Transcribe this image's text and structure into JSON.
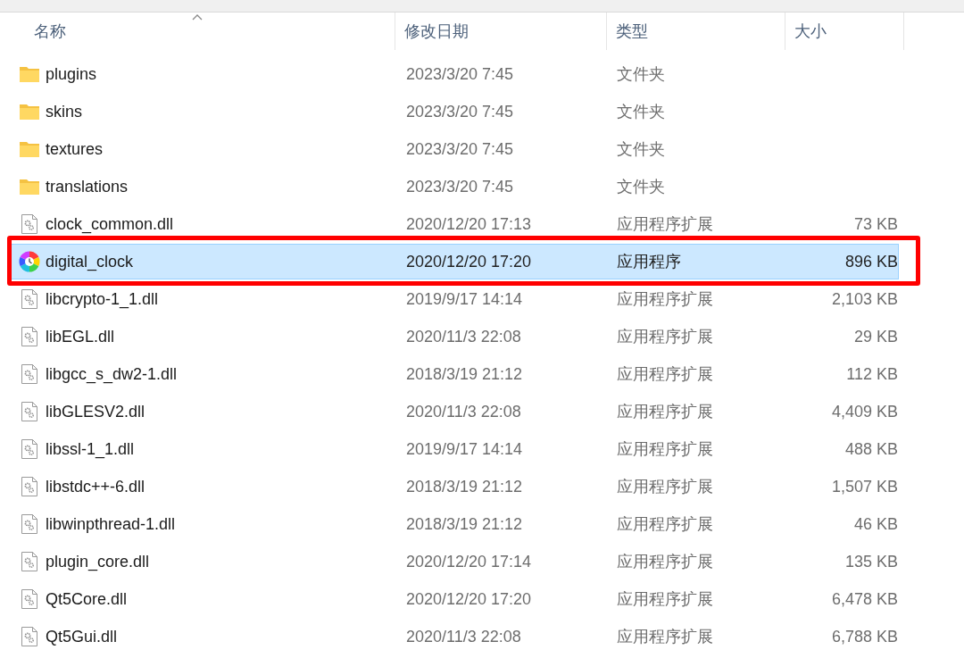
{
  "columns": [
    {
      "label": "名称",
      "sorted": true
    },
    {
      "label": "修改日期",
      "sorted": false
    },
    {
      "label": "类型",
      "sorted": false
    },
    {
      "label": "大小",
      "sorted": false
    }
  ],
  "rows": [
    {
      "kind": "folder",
      "name": "plugins",
      "date": "2023/3/20 7:45",
      "type": "文件夹",
      "selected": false,
      "annotated": false
    },
    {
      "kind": "folder",
      "name": "skins",
      "date": "2023/3/20 7:45",
      "type": "文件夹",
      "selected": false,
      "annotated": false
    },
    {
      "kind": "folder",
      "name": "textures",
      "date": "2023/3/20 7:45",
      "type": "文件夹",
      "selected": false,
      "annotated": false
    },
    {
      "kind": "folder",
      "name": "translations",
      "date": "2023/3/20 7:45",
      "type": "文件夹",
      "selected": false,
      "annotated": false
    },
    {
      "kind": "dll",
      "name": "clock_common.dll",
      "date": "2020/12/20 17:13",
      "type": "应用程序扩展",
      "size": "73 KB",
      "selected": false,
      "annotated": false
    },
    {
      "kind": "app",
      "name": "digital_clock",
      "date": "2020/12/20 17:20",
      "type": "应用程序",
      "size": "896 KB",
      "selected": true,
      "annotated": true
    },
    {
      "kind": "dll",
      "name": "libcrypto-1_1.dll",
      "date": "2019/9/17 14:14",
      "type": "应用程序扩展",
      "size": "2,103 KB",
      "selected": false,
      "annotated": false
    },
    {
      "kind": "dll",
      "name": "libEGL.dll",
      "date": "2020/11/3 22:08",
      "type": "应用程序扩展",
      "size": "29 KB",
      "selected": false,
      "annotated": false
    },
    {
      "kind": "dll",
      "name": "libgcc_s_dw2-1.dll",
      "date": "2018/3/19 21:12",
      "type": "应用程序扩展",
      "size": "112 KB",
      "selected": false,
      "annotated": false
    },
    {
      "kind": "dll",
      "name": "libGLESV2.dll",
      "date": "2020/11/3 22:08",
      "type": "应用程序扩展",
      "size": "4,409 KB",
      "selected": false,
      "annotated": false
    },
    {
      "kind": "dll",
      "name": "libssl-1_1.dll",
      "date": "2019/9/17 14:14",
      "type": "应用程序扩展",
      "size": "488 KB",
      "selected": false,
      "annotated": false
    },
    {
      "kind": "dll",
      "name": "libstdc++-6.dll",
      "date": "2018/3/19 21:12",
      "type": "应用程序扩展",
      "size": "1,507 KB",
      "selected": false,
      "annotated": false
    },
    {
      "kind": "dll",
      "name": "libwinpthread-1.dll",
      "date": "2018/3/19 21:12",
      "type": "应用程序扩展",
      "size": "46 KB",
      "selected": false,
      "annotated": false
    },
    {
      "kind": "dll",
      "name": "plugin_core.dll",
      "date": "2020/12/20 17:14",
      "type": "应用程序扩展",
      "size": "135 KB",
      "selected": false,
      "annotated": false
    },
    {
      "kind": "dll",
      "name": "Qt5Core.dll",
      "date": "2020/12/20 17:20",
      "type": "应用程序扩展",
      "size": "6,478 KB",
      "selected": false,
      "annotated": false
    },
    {
      "kind": "dll",
      "name": "Qt5Gui.dll",
      "date": "2020/11/3 22:08",
      "type": "应用程序扩展",
      "size": "6,788 KB",
      "selected": false,
      "annotated": false
    }
  ]
}
